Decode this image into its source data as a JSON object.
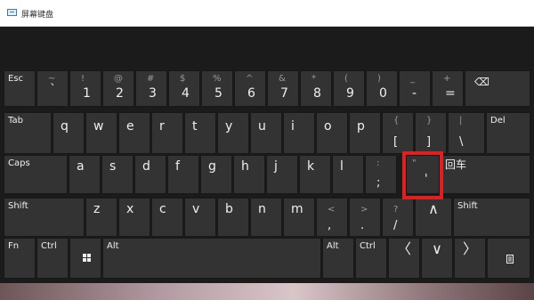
{
  "window": {
    "title": "屏幕键盘",
    "title_icon": "keyboard-app-icon"
  },
  "colors": {
    "key_bg": "#333333",
    "keyboard_bg": "#1b1b1b",
    "highlight": "#e02020"
  },
  "keys": {
    "esc": "Esc",
    "backtick": {
      "shift": "~",
      "main": "`"
    },
    "n1": {
      "shift": "!",
      "main": "1"
    },
    "n2": {
      "shift": "@",
      "main": "2"
    },
    "n3": {
      "shift": "#",
      "main": "3"
    },
    "n4": {
      "shift": "$",
      "main": "4"
    },
    "n5": {
      "shift": "%",
      "main": "5"
    },
    "n6": {
      "shift": "^",
      "main": "6"
    },
    "n7": {
      "shift": "&",
      "main": "7"
    },
    "n8": {
      "shift": "*",
      "main": "8"
    },
    "n9": {
      "shift": "(",
      "main": "9"
    },
    "n0": {
      "shift": ")",
      "main": "0"
    },
    "minus": {
      "shift": "_",
      "main": "-"
    },
    "equals": {
      "shift": "+",
      "main": "="
    },
    "backspace": "⌫",
    "tab": "Tab",
    "q": "q",
    "w": "w",
    "e": "e",
    "r": "r",
    "t": "t",
    "y": "y",
    "u": "u",
    "i": "i",
    "o": "o",
    "p": "p",
    "lbracket": {
      "shift": "{",
      "main": "["
    },
    "rbracket": {
      "shift": "}",
      "main": "]"
    },
    "backslash": {
      "shift": "|",
      "main": "\\"
    },
    "del": "Del",
    "caps": "Caps",
    "a": "a",
    "s": "s",
    "d": "d",
    "f": "f",
    "g": "g",
    "h": "h",
    "j": "j",
    "k": "k",
    "l": "l",
    "semicolon": {
      "shift": ":",
      "main": ";"
    },
    "quote": {
      "shift": "\"",
      "main": "'"
    },
    "enter": "回车",
    "shift_left": "Shift",
    "z": "z",
    "x": "x",
    "c": "c",
    "v": "v",
    "b": "b",
    "n": "n",
    "m": "m",
    "comma": {
      "shift": "<",
      "main": ","
    },
    "period": {
      "shift": ">",
      "main": "."
    },
    "slash": {
      "shift": "?",
      "main": "/"
    },
    "up": "∧",
    "shift_right": "Shift",
    "fn": "Fn",
    "ctrl_left": "Ctrl",
    "alt_left": "Alt",
    "alt_right": "Alt",
    "ctrl_right": "Ctrl",
    "left": "〈",
    "down": "∨",
    "right": "〉"
  }
}
